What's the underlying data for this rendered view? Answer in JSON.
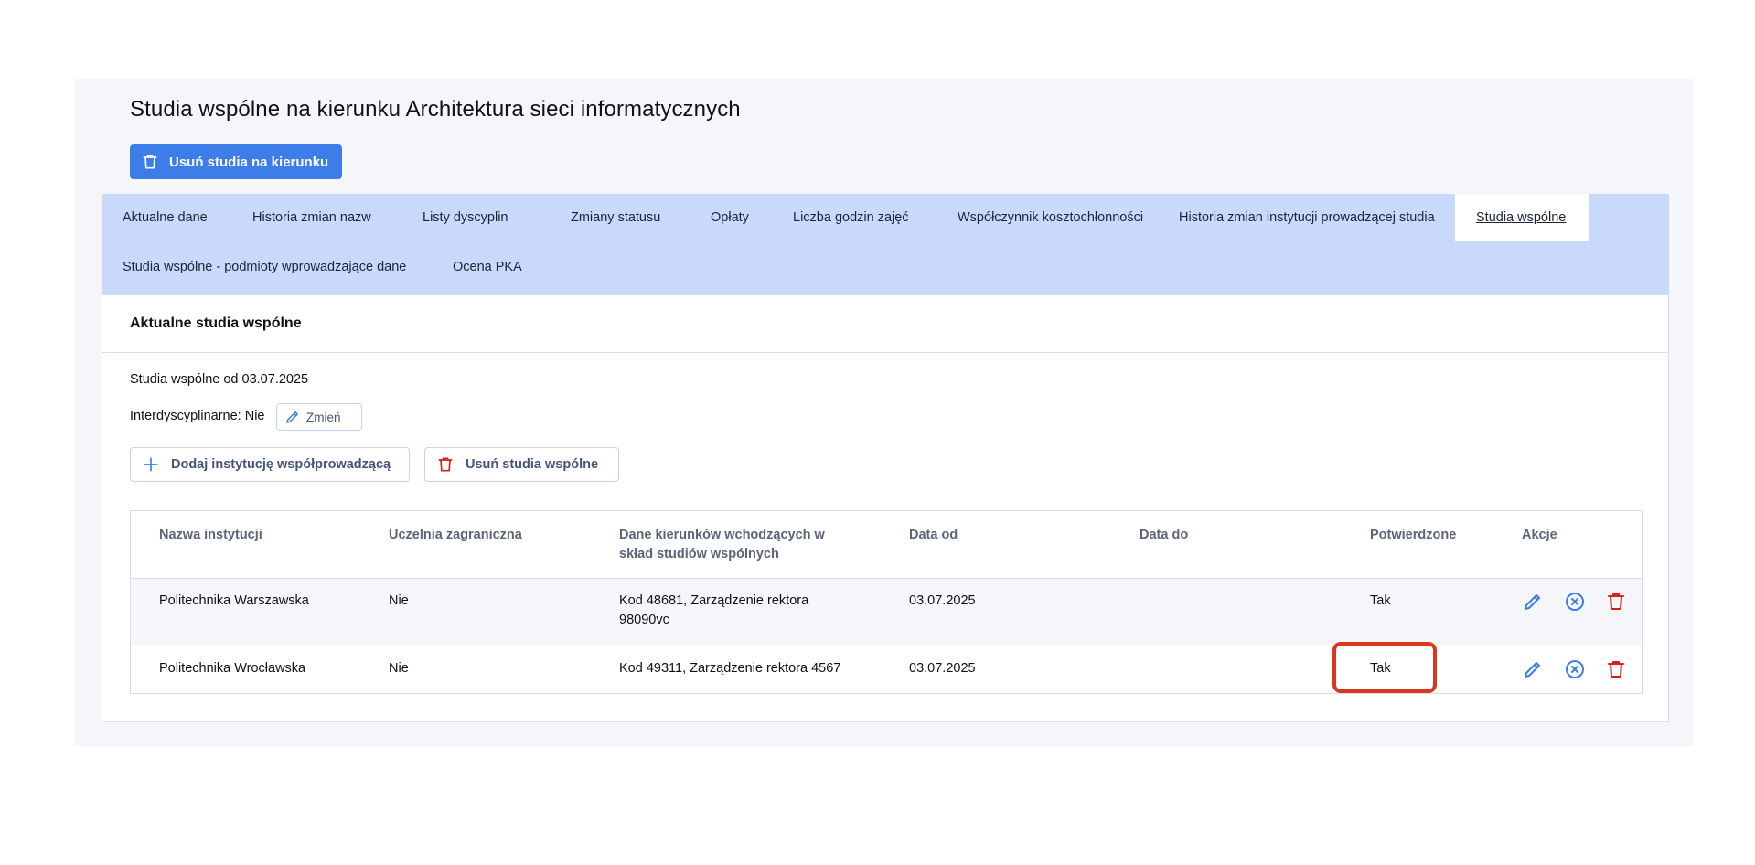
{
  "page": {
    "title": "Studia wspólne na kierunku Architektura sieci informatycznych",
    "delete_study_button": "Usuń studia na kierunku"
  },
  "tabs": [
    {
      "label": "Aktualne dane",
      "active": false
    },
    {
      "label": "Historia zmian nazw",
      "active": false
    },
    {
      "label": "Listy dyscyplin",
      "active": false
    },
    {
      "label": "Zmiany statusu",
      "active": false
    },
    {
      "label": "Opłaty",
      "active": false
    },
    {
      "label": "Liczba godzin zajęć",
      "active": false
    },
    {
      "label": "Współczynnik kosztochłonności",
      "active": false
    },
    {
      "label": "Historia zmian instytucji prowadzącej studia",
      "active": false
    },
    {
      "label": "Studia wspólne",
      "active": true
    },
    {
      "label": "Studia wspólne - podmioty wprowadzające dane",
      "active": false
    },
    {
      "label": "Ocena PKA",
      "active": false
    }
  ],
  "card": {
    "title": "Aktualne studia wspólne",
    "since_text": "Studia wspólne od 03.07.2025",
    "interdisciplinary_text": "Interdyscyplinarne: Nie",
    "change_button": "Zmień",
    "add_institution_button": "Dodaj instytucję współprowadzącą",
    "delete_joint_button": "Usuń studia wspólne"
  },
  "table": {
    "headers": {
      "name": "Nazwa instytucji",
      "foreign": "Uczelnia zagraniczna",
      "programs_line1": "Dane kierunków wchodzących w",
      "programs_line2": "skład studiów wspólnych",
      "date_from": "Data od",
      "date_to": "Data do",
      "confirmed": "Potwierdzone",
      "actions": "Akcje"
    },
    "rows": [
      {
        "name": "Politechnika Warszawska",
        "foreign": "Nie",
        "programs_line1": "Kod 48681, Zarządzenie rektora",
        "programs_line2": "98090vc",
        "date_from": "03.07.2025",
        "date_to": "",
        "confirmed": "Tak"
      },
      {
        "name": "Politechnika Wrocławska",
        "foreign": "Nie",
        "programs_line1": "Kod 49311, Zarządzenie rektora 4567",
        "programs_line2": "",
        "date_from": "03.07.2025",
        "date_to": "",
        "confirmed": "Tak"
      }
    ]
  },
  "colors": {
    "primary": "#3d7dea",
    "tab_bar": "#c8d9fb",
    "danger": "#d61f1f",
    "highlight": "#d9381e"
  },
  "icons": [
    "trash-icon",
    "pencil-icon",
    "plus-icon",
    "close-circle-icon"
  ]
}
